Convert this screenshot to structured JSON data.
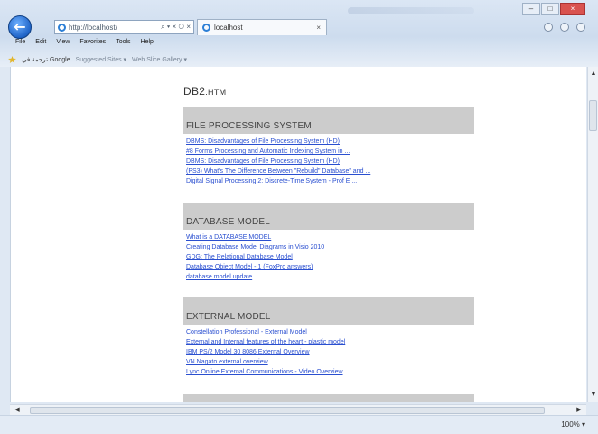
{
  "browser": {
    "address_text": "http://localhost/",
    "address_controls": "⌕ ▾ × ↻ ×",
    "tab_label": "localhost",
    "tab_close": "×",
    "back_glyph": "←",
    "window_controls": [
      "–",
      "□",
      "×"
    ],
    "menu": [
      "File",
      "Edit",
      "View",
      "Favorites",
      "Tools",
      "Help"
    ],
    "favorites": [
      {
        "label": "ترجمة في Google",
        "dim": false
      },
      {
        "label": "Suggested Sites ▾",
        "dim": true
      },
      {
        "label": "Web Slice Gallery ▾",
        "dim": true
      }
    ],
    "zoom_label": "100% ▾",
    "scroll_up": "▲",
    "scroll_down": "▼",
    "scroll_left": "◀",
    "scroll_right": "▶"
  },
  "page": {
    "title_main": "DB2",
    "title_ext": ".HTM",
    "sections": [
      {
        "header": "FILE PROCESSING SYSTEM",
        "links": [
          "DBMS: Disadvantages of File Processing System (HD)",
          "#8 Forms Processing and Automatic Indexing System in ...",
          "DBMS: Disadvantages of File Processing System (HD)",
          "(PS3) What's The Difference Between \"Rebuild\" Database\" and ...",
          "Digital Signal Processing 2: Discrete-Time System - Prof E ..."
        ]
      },
      {
        "header": "DATABASE MODEL",
        "links": [
          "What is a DATABASE MODEL",
          "Creating Database Model Diagrams in Visio 2010",
          "GDG: The Relational Database Model",
          "Database Object Model - 1 (FoxPro answers)",
          "database model update"
        ]
      },
      {
        "header": "EXTERNAL MODEL",
        "links": [
          "Constellation Professional - External Model",
          "External and Internal features of the heart - plastic model",
          "IBM PS/2 Model 30 8086 External Overview",
          "VN Nagato external overview",
          "Lync Online External Communications - Video Overview"
        ]
      }
    ]
  }
}
